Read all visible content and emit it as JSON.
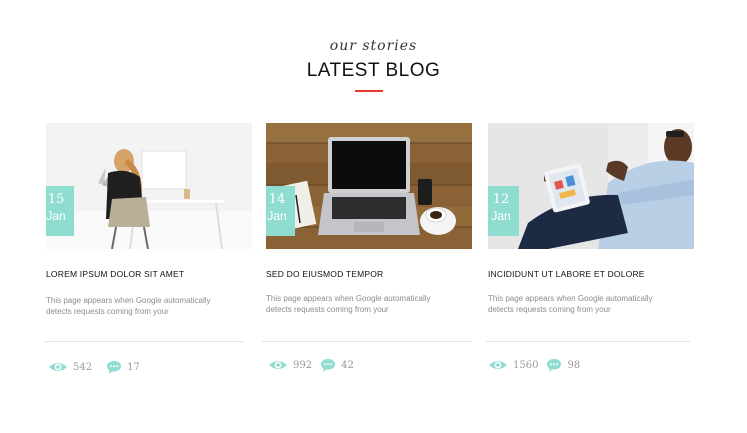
{
  "section": {
    "script_heading": "our stories",
    "title": "LATEST BLOG",
    "accent_color": "#e8392d",
    "badge_color": "#8fddd1",
    "icon_color": "#8fddd1"
  },
  "posts": [
    {
      "day": "15",
      "month": "Jan",
      "title": "LOREM IPSUM DOLOR SIT AMET",
      "excerpt": "This page appears when Google automatically detects requests coming from your",
      "views": "542",
      "comments": "17",
      "image": "woman-at-desk-photo"
    },
    {
      "day": "14",
      "month": "Jan",
      "title": "SED DO EIUSMOD TEMPOR",
      "excerpt": "This page appears when Google automatically detects requests coming from your",
      "views": "992",
      "comments": "42",
      "image": "laptop-on-wooden-table-photo"
    },
    {
      "day": "12",
      "month": "Jan",
      "title": "INCIDIDUNT UT LABORE ET DOLORE",
      "excerpt": "This page appears when Google automatically detects requests coming from your",
      "views": "1560",
      "comments": "98",
      "image": "man-with-tablet-photo"
    }
  ]
}
